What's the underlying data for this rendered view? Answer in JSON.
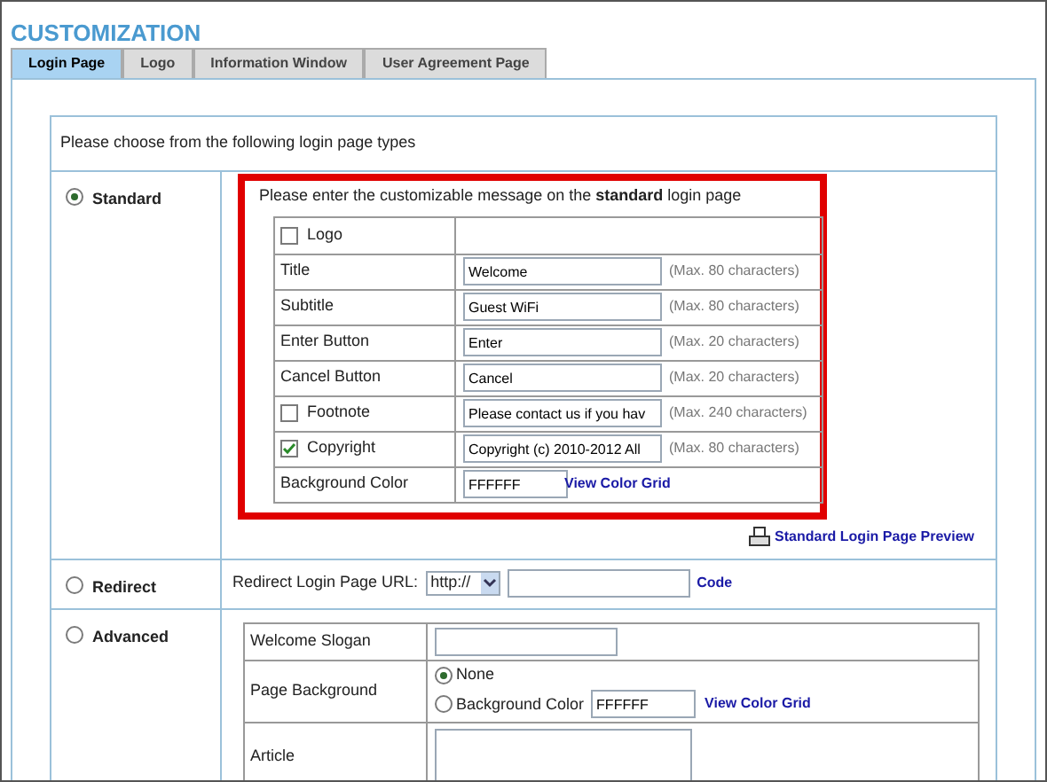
{
  "title": "CUSTOMIZATION",
  "tabs": [
    {
      "label": "Login Page",
      "selected": true
    },
    {
      "label": "Logo",
      "selected": false
    },
    {
      "label": "Information Window",
      "selected": false
    },
    {
      "label": "User Agreement Page",
      "selected": false
    }
  ],
  "prompt": "Please choose from the following login page types",
  "standard": {
    "label": "Standard",
    "selected": true,
    "message": "Please enter the customizable message on the **standard** login page",
    "rows": [
      {
        "kind": "checkbox",
        "label": "Logo",
        "checked": false
      },
      {
        "kind": "text",
        "label": "Title",
        "value": "Welcome",
        "hint": "(Max. 80 characters)"
      },
      {
        "kind": "text",
        "label": "Subtitle",
        "value": "Guest WiFi",
        "hint": "(Max. 80 characters)"
      },
      {
        "kind": "text",
        "label": "Enter Button",
        "value": "Enter",
        "hint": "(Max. 20 characters)"
      },
      {
        "kind": "text",
        "label": "Cancel Button",
        "value": "Cancel",
        "hint": "(Max. 20 characters)"
      },
      {
        "kind": "checkbox",
        "label": "Footnote",
        "checked": false,
        "value": "Please contact us if you hav",
        "hint": "(Max. 240 characters)"
      },
      {
        "kind": "checkbox",
        "label": "Copyright",
        "checked": true,
        "value": "Copyright (c) 2010-2012 All",
        "hint": "(Max. 80 characters)"
      },
      {
        "kind": "color",
        "label": "Background Color",
        "value": "FFFFFF",
        "link": "View Color Grid"
      }
    ],
    "preview": "Standard Login Page Preview"
  },
  "redirect": {
    "label": "Redirect",
    "selected": false,
    "url_label": "Redirect Login Page URL:",
    "protocol": "http://",
    "link": "Code"
  },
  "advanced": {
    "label": "Advanced",
    "selected": false,
    "welcome_slogan": "Welcome Slogan",
    "page_background": {
      "label": "Page Background",
      "options": [
        {
          "label": "None",
          "selected": true
        },
        {
          "label": "Background Color",
          "selected": false,
          "value": "FFFFFF",
          "link": "View Color Grid"
        }
      ]
    },
    "article": "Article"
  }
}
